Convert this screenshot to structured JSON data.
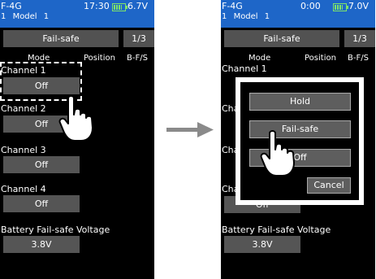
{
  "left_screen": {
    "status": {
      "radio": "F-4G",
      "time": "17:30",
      "voltage": "6.7V",
      "model_number": "1",
      "model_name": "Model 1"
    },
    "header": {
      "title": "Fail-safe",
      "page": "1/3"
    },
    "columns": {
      "mode": "Mode",
      "position": "Position",
      "bfs": "B-F/S"
    },
    "channels": [
      {
        "label": "Channel 1",
        "mode": "Off"
      },
      {
        "label": "Channel 2",
        "mode": "Off"
      },
      {
        "label": "Channel 3",
        "mode": "Off"
      },
      {
        "label": "Channel 4",
        "mode": "Off"
      }
    ],
    "battery_fs": {
      "label": "Battery Fail-safe Voltage",
      "value": "3.8V"
    }
  },
  "right_screen": {
    "status": {
      "radio": "F-4G",
      "time": "0:00",
      "voltage": "7.0V",
      "model_number": "1",
      "model_name": "Model 1"
    },
    "header": {
      "title": "Fail-safe",
      "page": "1/3"
    },
    "columns": {
      "mode": "Mode",
      "position": "Position",
      "bfs": "B-F/S"
    },
    "channel1_label": "Channel 1",
    "partial_labels": [
      "Cha",
      "Cha",
      "Cha"
    ],
    "channel4_value": "Off",
    "battery_fs": {
      "label": "Battery Fail-safe Voltage",
      "value": "3.8V"
    },
    "popup": {
      "hold": "Hold",
      "failsafe": "Fail-safe",
      "off": "Off",
      "cancel": "Cancel"
    }
  },
  "icons": [
    "battery-icon",
    "hand-pointer-icon",
    "arrow-right-icon"
  ],
  "colors": {
    "status_bar": "#1e66c8",
    "button": "#555555",
    "screen_bg": "#000000",
    "arrow": "#8a8a8a",
    "battery": "#7ee36a"
  }
}
